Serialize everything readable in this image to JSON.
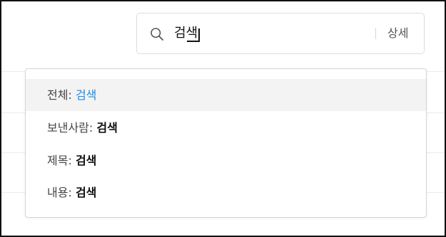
{
  "search": {
    "value": "검색",
    "detail_label": "상세"
  },
  "suggestions": [
    {
      "label": "전체",
      "term": "검색",
      "selected": true
    },
    {
      "label": "보낸사람",
      "term": "검색",
      "selected": false
    },
    {
      "label": "제목",
      "term": "검색",
      "selected": false
    },
    {
      "label": "내용",
      "term": "검색",
      "selected": false
    }
  ],
  "separator": ": ",
  "colors": {
    "accent": "#2f87d4",
    "highlight_bg": "#f3f3f3",
    "border": "#dcdcdc"
  },
  "icons": {
    "search": "search-icon"
  }
}
